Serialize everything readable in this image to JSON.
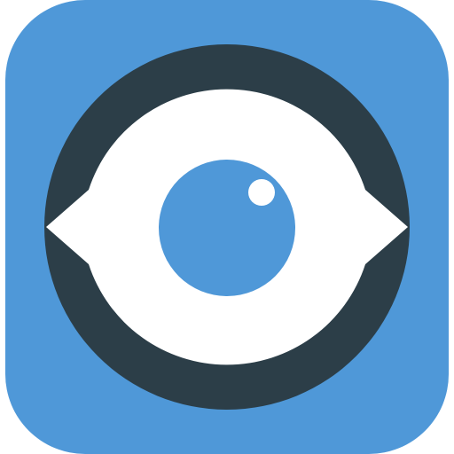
{
  "app_icon": {
    "icon": "eye-icon",
    "colors": {
      "background": "#4f98d8",
      "ring": "#2c3e48",
      "sclera": "#ffffff",
      "iris": "#4f98d8",
      "highlight": "#ffffff"
    }
  }
}
